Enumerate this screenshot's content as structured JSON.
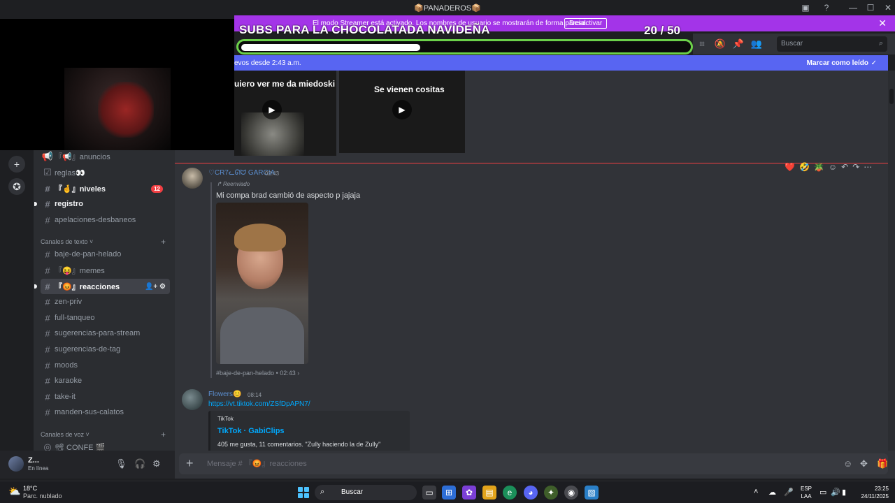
{
  "window": {
    "title": "📦PANADEROS📦",
    "controls": [
      "—",
      "☐",
      "✕"
    ]
  },
  "streamer_banner": {
    "text": "El modo Streamer está activado. Los nombres de usuario se mostrarán de forma parcial.",
    "button": "Desactivar",
    "close": "✕"
  },
  "subs_goal": {
    "title": "SUBS PARA LA CHOCOLATADA NAVIDEÑA",
    "count": "20  / 50",
    "current": 20,
    "target": 50,
    "fraction": 0.4
  },
  "header": {
    "search_placeholder": "Buscar"
  },
  "new_messages": {
    "text": "evos desde 2:43 a.m.",
    "mark_read": "Marcar como leído"
  },
  "videos": [
    {
      "caption": "uiero ver me da miedoski"
    },
    {
      "caption": "Se vienen cositas"
    }
  ],
  "channels": {
    "top": [
      {
        "name": "『📢』anuncios",
        "icon": "📢"
      },
      {
        "name": "reglas👀",
        "icon": "☑"
      },
      {
        "name": "『🤞』niveles",
        "icon": "#",
        "badge": "12",
        "bold": true
      },
      {
        "name": "registro",
        "icon": "#",
        "bold": true
      },
      {
        "name": "apelaciones-desbaneos",
        "icon": "#"
      }
    ],
    "text_category": "Canales de texto ˅",
    "text_channels": [
      {
        "name": "baje-de-pan-helado"
      },
      {
        "name": "『😝』memes"
      },
      {
        "name": "『😡』reacciones",
        "selected": true
      },
      {
        "name": "zen-priv"
      },
      {
        "name": "full-tanqueo"
      },
      {
        "name": "sugerencias-para-stream"
      },
      {
        "name": "sugerencias-de-tag"
      },
      {
        "name": "moods"
      },
      {
        "name": "karaoke"
      },
      {
        "name": "take-it"
      },
      {
        "name": "manden-sus-calatos"
      }
    ],
    "voice_category": "Canales de voz ˅",
    "voice_channels": [
      {
        "name": "📽 CONFE 🎬"
      }
    ]
  },
  "user": {
    "name": "Z...",
    "status": "En línea"
  },
  "messages": [
    {
      "author": "♡CR7ᓚᘏᗢ GARCIA",
      "time": "02:43",
      "forwarded_label": "Reenviado",
      "text": "Mi compa brad cambió de aspecto p jajaja",
      "source": "#baje-de-pan-helado • 02:43 ›"
    },
    {
      "author": "Flowers😊",
      "time": "08:14",
      "link": "https://vt.tiktok.com/ZSfDpAPN7/",
      "embed": {
        "provider": "TikTok",
        "title": "TikTok · GabiClips",
        "description": "405 me gusta, 11 comentarios. \"Zully haciendo la de Zully\""
      }
    }
  ],
  "reactions": [
    "❤️",
    "🤣",
    "🪴"
  ],
  "input": {
    "placeholder": "Mensaje # 『😡』reacciones"
  },
  "taskbar": {
    "temp": "18°C",
    "weather": "Parc. nublado",
    "search": "Buscar",
    "lang_top": "ESP",
    "lang_bottom": "LAA",
    "time": "23:25",
    "date": "24/11/2025"
  },
  "colors": {
    "streamer_banner": "#a334e8",
    "new_messages_bar": "#5865f2",
    "goal_border": "#6cd14a",
    "unread_badge": "#f23f43"
  }
}
